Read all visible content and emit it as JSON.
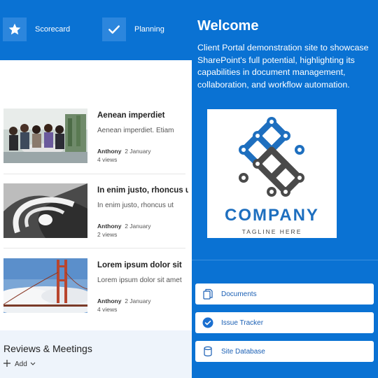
{
  "quick_links": [
    {
      "label": "Scorecard",
      "icon": "star-icon"
    },
    {
      "label": "Planning",
      "icon": "checkmark-icon"
    }
  ],
  "news": [
    {
      "title": "Aenean imperdiet",
      "description": "Aenean imperdiet. Etiam",
      "author": "Anthony",
      "date": "2 January",
      "views": "4 views"
    },
    {
      "title": "In enim justo, rhoncus ut",
      "description": "In enim justo, rhoncus ut",
      "author": "Anthony",
      "date": "2 January",
      "views": "2 views"
    },
    {
      "title": "Lorem ipsum dolor sit",
      "description": "Lorem ipsum dolor sit amet",
      "author": "Anthony",
      "date": "2 January",
      "views": "4 views"
    }
  ],
  "reviews": {
    "title": "Reviews & Meetings",
    "add_label": "Add"
  },
  "welcome": {
    "title": "Welcome",
    "description": "Client Portal demonstration site to showcase SharePoint's full potential, highlighting its capabilities in document management, collaboration, and workflow automation."
  },
  "logo": {
    "company": "COMPANY",
    "tagline": "TAGLINE HERE"
  },
  "links": [
    {
      "label": "Documents",
      "icon": "documents-icon"
    },
    {
      "label": "Issue Tracker",
      "icon": "check-circle-icon"
    },
    {
      "label": "Site Database",
      "icon": "database-icon"
    }
  ],
  "colors": {
    "accent": "#0a72d3",
    "tile": "#2c86dd",
    "link_text": "#1a5fb4",
    "logo_blue": "#1e6fbf",
    "logo_gray": "#4a4a4a"
  }
}
